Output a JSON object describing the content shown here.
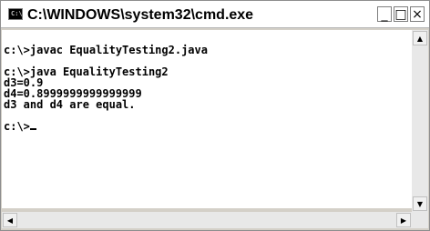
{
  "window": {
    "title": "C:\\WINDOWS\\system32\\cmd.exe",
    "icon": "cmd-icon",
    "icon_glyph": "C:\\"
  },
  "controls": {
    "minimize": "_",
    "maximize": "□",
    "close": "×"
  },
  "console": {
    "lines": [
      "",
      "c:\\>javac EqualityTesting2.java",
      "",
      "c:\\>java EqualityTesting2",
      "d3=0.9",
      "d4=0.8999999999999999",
      "d3 and d4 are equal.",
      "",
      "c:\\>"
    ]
  },
  "scrollbars": {
    "up": "▲",
    "down": "▼",
    "left": "◀",
    "right": "▶"
  },
  "colors": {
    "console_bg": "#ffffff",
    "console_text": "#000000",
    "scroll_track": "#e8e8e8"
  }
}
